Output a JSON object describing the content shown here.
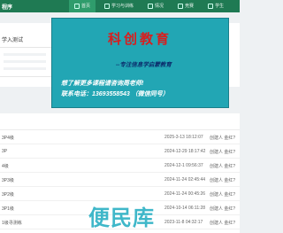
{
  "header": {
    "logo": "程序",
    "nav": [
      {
        "label": "首页",
        "active": true
      },
      {
        "label": "学习与训练",
        "active": false
      },
      {
        "label": "情况",
        "active": false
      },
      {
        "label": "竞赛",
        "active": false
      },
      {
        "label": "学生",
        "active": false
      }
    ]
  },
  "card1": {
    "title": "学入测试"
  },
  "ad": {
    "title": "科创教育",
    "subtitle": "--专注信息学启蒙教育",
    "line1": "想了解更多课程请咨询周老师!",
    "line2": "联系电话：13693558543 （微信同号）"
  },
  "list": {
    "header": "",
    "rows": [
      {
        "name": "3P4级",
        "time": "2025-3-13 18:12:07",
        "creator": "创建人 金红?"
      },
      {
        "name": "3P",
        "time": "2024-12-29 18:17:42",
        "creator": "创建人 金红?"
      },
      {
        "name": "4级",
        "time": "2024-12-1 09:56:37",
        "creator": "创建人 金红?"
      },
      {
        "name": "3P3级",
        "time": "2024-11-24 02:45:44",
        "creator": "创建人 金红?"
      },
      {
        "name": "3P2级",
        "time": "2024-11-24 00:45:26",
        "creator": "创建人 金红?"
      },
      {
        "name": "3P1级",
        "time": "2024-10-14 06:11:28",
        "creator": "创建人 金红?"
      },
      {
        "name": "1级寻测练",
        "time": "2023-11-8 04:32:17",
        "creator": "创建人 金红?"
      }
    ]
  },
  "watermark": "便民库"
}
